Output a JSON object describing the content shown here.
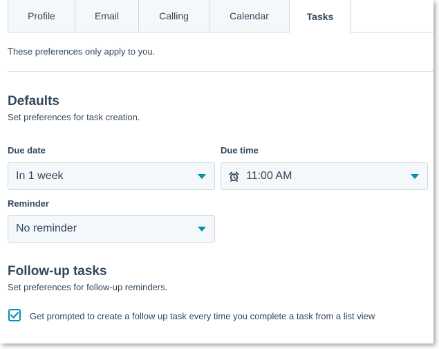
{
  "tabs": [
    {
      "label": "Profile"
    },
    {
      "label": "Email"
    },
    {
      "label": "Calling"
    },
    {
      "label": "Calendar"
    },
    {
      "label": "Tasks",
      "active": true
    }
  ],
  "note": "These preferences only apply to you.",
  "defaults": {
    "title": "Defaults",
    "subtitle": "Set preferences for task creation.",
    "due_date": {
      "label": "Due date",
      "value": "In 1 week"
    },
    "due_time": {
      "label": "Due time",
      "value": "11:00 AM"
    },
    "reminder": {
      "label": "Reminder",
      "value": "No reminder"
    }
  },
  "followup": {
    "title": "Follow-up tasks",
    "subtitle": "Set preferences for follow-up reminders.",
    "checkbox_label": "Get prompted to create a follow up task every time you complete a task from a list view",
    "checked": true
  },
  "colors": {
    "accent": "#0091ae",
    "text": "#33475b",
    "border": "#cbd6e2",
    "field_bg": "#f5f8fa"
  }
}
